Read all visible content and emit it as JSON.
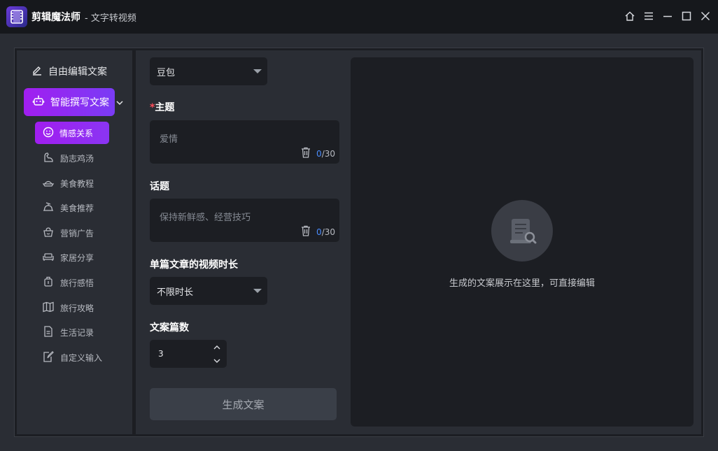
{
  "app": {
    "title": "剪辑魔法师",
    "subtitle": "- 文字转视频"
  },
  "window_controls": [
    "home-icon",
    "menu-icon",
    "minimize-icon",
    "maximize-icon",
    "close-icon"
  ],
  "sidebar": {
    "top_item": "自由编辑文案",
    "active_item": "智能撰写文案",
    "sub_items": [
      "情感关系",
      "励志鸡汤",
      "美食教程",
      "美食推荐",
      "营销广告",
      "家居分享",
      "旅行感悟",
      "旅行攻略",
      "生活记录",
      "自定义输入"
    ]
  },
  "form": {
    "model_select": "豆包",
    "subject_label": "主题",
    "subject_required_mark": "*",
    "subject_placeholder": "爱情",
    "subject_count": "0",
    "subject_max": "/30",
    "topic_label": "话题",
    "topic_placeholder": "保持新鲜感、经营技巧",
    "topic_count": "0",
    "topic_max": "/30",
    "duration_label": "单篇文章的视频时长",
    "duration_select": "不限时长",
    "count_label": "文案篇数",
    "count_value": "3",
    "generate_button": "生成文案"
  },
  "preview": {
    "empty_text": "生成的文案展示在这里，可直接编辑"
  },
  "colors": {
    "accent_start": "#a11ef0",
    "accent_end": "#7a3cf5",
    "counter_accent": "#4b8dff",
    "required": "#ff4d5a"
  }
}
